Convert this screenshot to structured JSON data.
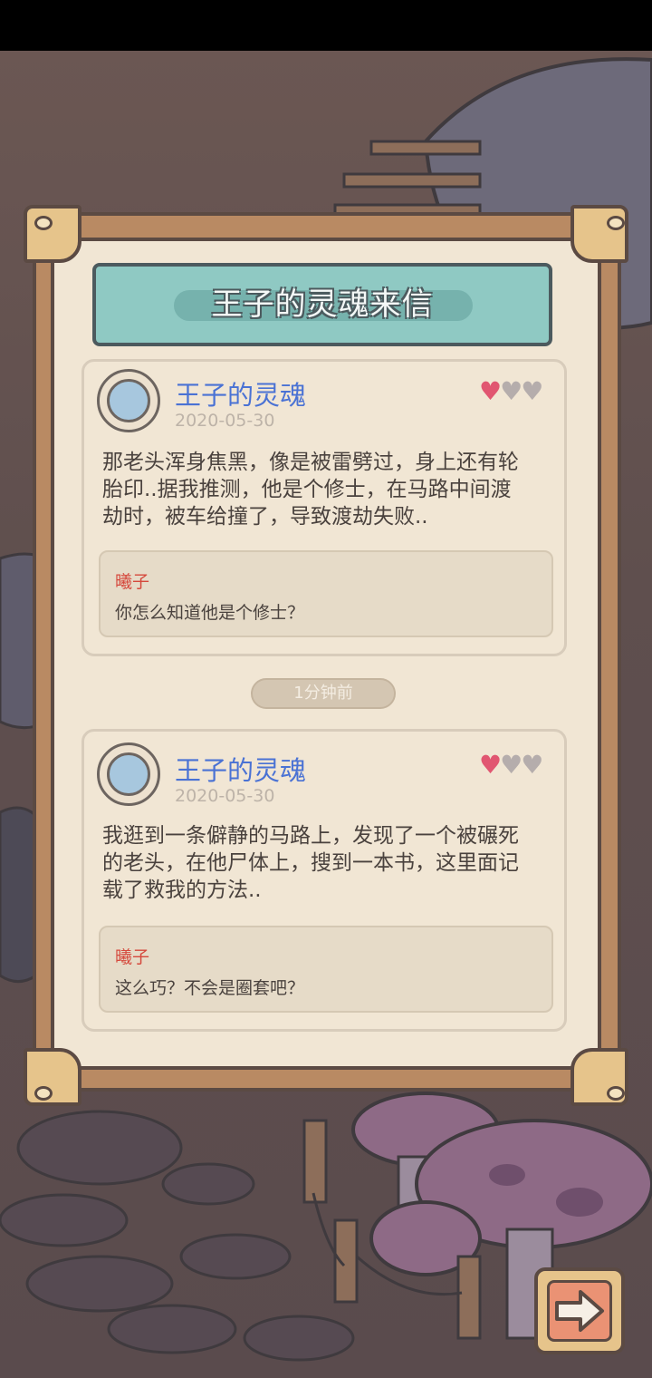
{
  "dialog": {
    "title": "王子的灵魂来信"
  },
  "messages": [
    {
      "sender": "王子的灵魂",
      "date": "2020-05-30",
      "rating_filled": 1,
      "rating_max": 3,
      "text_lines": [
        "那老头浑身焦黑，像是被雷劈过，身上还有轮",
        "胎印..据我推测，他是个修士，在马路中间渡",
        "劫时，被车给撞了，导致渡劫失败.."
      ],
      "reply": {
        "name": "曦子",
        "text": "你怎么知道他是个修士？"
      }
    },
    {
      "sender": "王子的灵魂",
      "date": "2020-05-30",
      "rating_filled": 1,
      "rating_max": 3,
      "text_lines": [
        "我逛到一条僻静的马路上，发现了一个被碾死",
        "的老头，在他尸体上，搜到一本书，这里面记",
        "载了救我的方法.."
      ],
      "reply": {
        "name": "曦子",
        "text": "这么巧？不会是圈套吧？"
      }
    }
  ],
  "divider": {
    "time_label": "1分钟前"
  },
  "icons": {
    "next": "arrow-right-icon",
    "avatar": "ghost-icon",
    "rating": "heart-icon"
  },
  "colors": {
    "sender": "#4a72d4",
    "reply_name": "#d5483c",
    "heart_on": "#e15671",
    "heart_off": "#b5adac",
    "banner": "#8fc9c3"
  }
}
